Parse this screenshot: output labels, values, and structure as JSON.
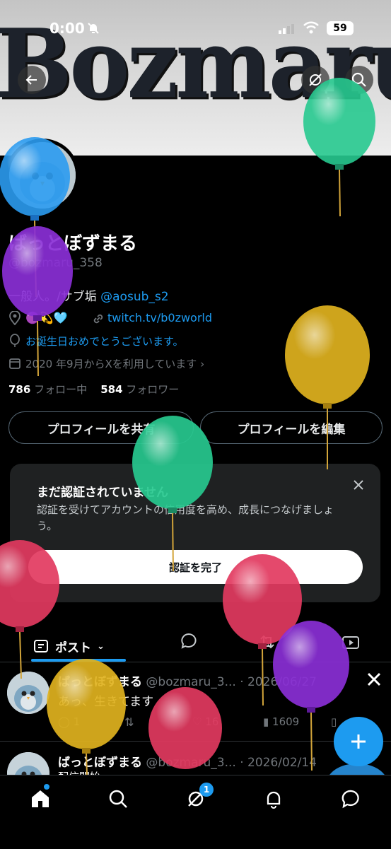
{
  "status": {
    "time": "0:00",
    "battery": "59"
  },
  "banner": {
    "logo_text": "Bozmaru"
  },
  "profile": {
    "display_name": "ばっとぼずまる",
    "handle": "@bozmaru_358",
    "bio_prefix": "一般人。/サブ垢 ",
    "bio_mention": "@aosub_s2",
    "location_emoji": "🟣💫🩵",
    "website": "twitch.tv/b0zworld",
    "birthday": "お誕生日おめでとうございます。",
    "joined": "2020 年9月からXを利用しています",
    "following_count": "786",
    "following_label": "フォロー中",
    "followers_count": "584",
    "followers_label": "フォロワー"
  },
  "buttons": {
    "share": "プロフィールを共有",
    "edit": "プロフィールを編集"
  },
  "verify": {
    "title": "まだ認証されていません",
    "body": "認証を受けてアカウントの信用度を高め、成長につなげましょう。",
    "cta": "認証を完了"
  },
  "tabs": {
    "posts": "ポスト"
  },
  "posts": [
    {
      "name": "ばっとぼずまる",
      "handle": "@bozmaru_3...",
      "date": "· 2026/06/27",
      "text": "あっ、生きてます",
      "replies": "1",
      "likes": "16",
      "views": "1609"
    },
    {
      "name": "ばっとぼずまる",
      "handle": "@bozmaru_3...",
      "date": "· 2026/02/14",
      "text": "配信開始"
    }
  ],
  "nav": {
    "notif_badge": "1"
  },
  "colors": {
    "accent": "#1d9bf0",
    "balloon_blue": "#2b9bf0",
    "balloon_purple": "#8a2fd6",
    "balloon_green": "#27c98f",
    "balloon_yellow": "#e0b21e",
    "balloon_red": "#e2395f"
  }
}
